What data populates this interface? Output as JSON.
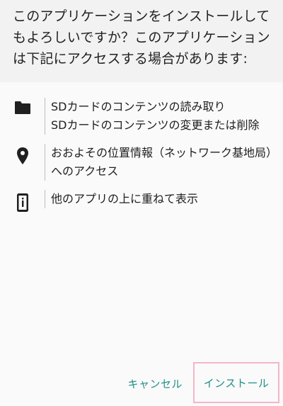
{
  "dialog": {
    "message": "このアプリケーションをインストールしてもよろしいですか？このアプリケーションは下記にアクセスする場合があります:"
  },
  "permissions": [
    {
      "icon": "folder-icon",
      "lines": [
        "SDカードのコンテンツの読み取り",
        "SDカードのコンテンツの変更または削除"
      ]
    },
    {
      "icon": "location-pin-icon",
      "lines": [
        "おおよその位置情報（ネットワーク基地局）へのアクセス"
      ]
    },
    {
      "icon": "phone-overlay-icon",
      "lines": [
        "他のアプリの上に重ねて表示"
      ]
    }
  ],
  "actions": {
    "cancel_label": "キャンセル",
    "install_label": "インストール"
  },
  "colors": {
    "accent": "#1e9089",
    "header_bg": "#f2f2f2",
    "highlight_border": "#f4b6c8"
  }
}
